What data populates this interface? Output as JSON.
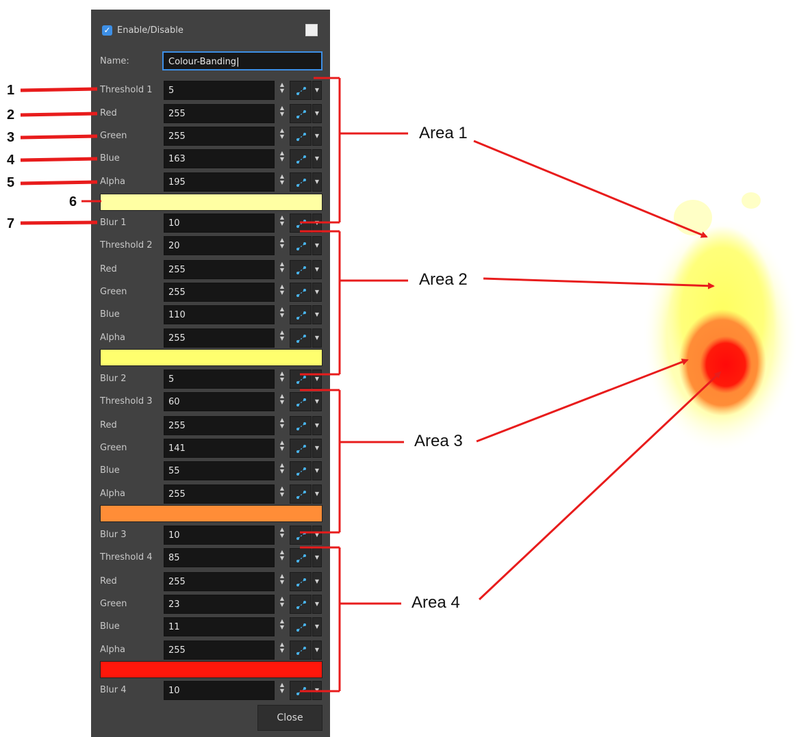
{
  "panel": {
    "enable_label": "Enable/Disable",
    "name_label": "Name:",
    "name_value": "Colour-Banding",
    "close_label": "Close"
  },
  "rows": [
    {
      "label": "Threshold 1",
      "value": "5"
    },
    {
      "label": "Red",
      "value": "255"
    },
    {
      "label": "Green",
      "value": "255"
    },
    {
      "label": "Blue",
      "value": "163"
    },
    {
      "label": "Alpha",
      "value": "195"
    },
    {
      "label": "Blur 1",
      "value": "10"
    },
    {
      "label": "Threshold 2",
      "value": "20"
    },
    {
      "label": "Red",
      "value": "255"
    },
    {
      "label": "Green",
      "value": "255"
    },
    {
      "label": "Blue",
      "value": "110"
    },
    {
      "label": "Alpha",
      "value": "255"
    },
    {
      "label": "Blur 2",
      "value": "5"
    },
    {
      "label": "Threshold 3",
      "value": "60"
    },
    {
      "label": "Red",
      "value": "255"
    },
    {
      "label": "Green",
      "value": "141"
    },
    {
      "label": "Blue",
      "value": "55"
    },
    {
      "label": "Alpha",
      "value": "255"
    },
    {
      "label": "Blur 3",
      "value": "10"
    },
    {
      "label": "Threshold 4",
      "value": "85"
    },
    {
      "label": "Red",
      "value": "255"
    },
    {
      "label": "Green",
      "value": "23"
    },
    {
      "label": "Blue",
      "value": "11"
    },
    {
      "label": "Alpha",
      "value": "255"
    },
    {
      "label": "Blur 4",
      "value": "10"
    }
  ],
  "color_swatches": [
    "#ffffa3",
    "#ffff6e",
    "#ff8d37",
    "#ff170b"
  ],
  "callout_numbers": [
    "1",
    "2",
    "3",
    "4",
    "5",
    "6",
    "7"
  ],
  "area_labels": [
    "Area 1",
    "Area 2",
    "Area 3",
    "Area 4"
  ],
  "colors": {
    "panel_bg": "#414141",
    "field_bg": "#161616",
    "accent": "#3d8fe6",
    "annotation_red": "#e81c1c"
  }
}
